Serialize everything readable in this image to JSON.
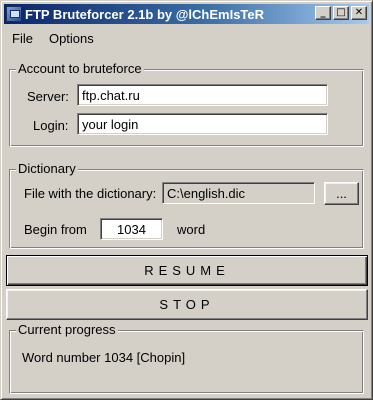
{
  "window": {
    "title": "FTP Bruteforcer 2.1b by @lChEmIsTeR",
    "controls": {
      "minimize": "_",
      "maximize": "□",
      "close": "✕"
    }
  },
  "menu": {
    "items": [
      "File",
      "Options"
    ]
  },
  "account": {
    "group_label": "Account to bruteforce",
    "server_label": "Server:",
    "server_value": "ftp.chat.ru",
    "login_label": "Login:",
    "login_value": "your login"
  },
  "dictionary": {
    "group_label": "Dictionary",
    "file_label": "File with the dictionary:",
    "file_value": "C:\\english.dic",
    "browse_label": "...",
    "begin_label": "Begin from",
    "begin_value": "1034",
    "word_label": "word"
  },
  "actions": {
    "resume_label": "RESUME",
    "stop_label": "STOP"
  },
  "progress": {
    "group_label": "Current progress",
    "status_text": "Word number 1034 [Chopin]"
  }
}
